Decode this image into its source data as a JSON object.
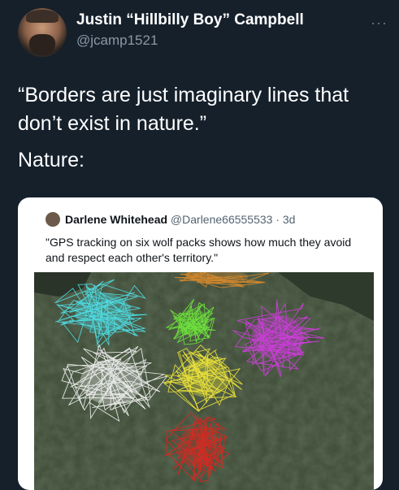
{
  "tweet": {
    "author_name": "Justin “Hillbilly Boy” Campbell",
    "author_handle": "@jcamp1521",
    "more_label": "···",
    "text_line1": "“Borders are just imaginary lines that don’t exist in nature.”",
    "text_line2": "Nature:"
  },
  "quoted": {
    "author_name": "Darlene Whitehead",
    "author_handle": "@Darlene66555533",
    "age": "· 3d",
    "text": "\"GPS tracking on six wolf packs shows how much they avoid and respect each other's territory.\""
  },
  "map": {
    "territory_colors": {
      "cyan": "#4fe0e8",
      "green": "#6ee83a",
      "magenta": "#d23ce0",
      "white": "#f4f4f4",
      "yellow": "#f2e83a",
      "red": "#e0251e",
      "orange": "#d98a2a"
    }
  },
  "colors": {
    "background": "#15202b",
    "card_background": "#ffffff"
  }
}
